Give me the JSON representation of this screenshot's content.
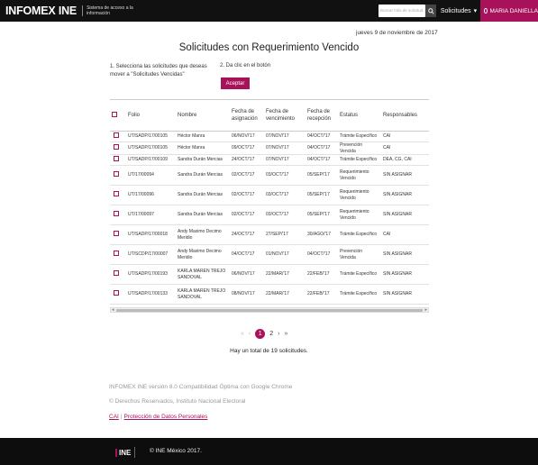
{
  "header": {
    "brand": "INFOMEX INE",
    "brand_sub": "Sistema de acceso a la información",
    "search_placeholder": "Buscar folio de solicitud",
    "solicitudes_label": "Solicitudes",
    "user_name": "MARIA DANIELLA",
    "accent": "#a8125b"
  },
  "main": {
    "date": "jueves 9 de noviembre de 2017",
    "title": "Solicitudes con Requerimiento Vencido",
    "step1": "1. Selecciona las solicitudes que deseas mover a \"Solicitudes Vencidas\"",
    "step2": "2. Da clic en el botón",
    "accept_label": "Aceptar"
  },
  "table": {
    "headers": [
      "Folio",
      "Nombre",
      "Fecha de asignación",
      "Fecha de vencimiento",
      "Fecha de recepción",
      "Estatus",
      "Responsables"
    ],
    "rows": [
      [
        "UT/SADP/17/00105",
        "Héctor Manra",
        "06/NOV/'17",
        "07/NOV/'17",
        "04/OCT/'17",
        "Trámite Específico",
        "CAI"
      ],
      [
        "UT/SADP/17/00105",
        "Héctor Manra",
        "09/OCT/'17",
        "07/NOV/'17",
        "04/OCT/'17",
        "Prevención Vencida",
        "CAI"
      ],
      [
        "UT/SADP/17/00109",
        "Sandra Durán Mercias",
        "24/OCT/'17",
        "07/NOV/'17",
        "04/OCT/'17",
        "Trámite Específico",
        "DEA, CG, CAI"
      ],
      [
        "UT/17/00094",
        "Sandra Durán Mercias",
        "02/OCT/'17",
        "03/OCT/'17",
        "05/SEP/'17",
        "Requerimiento Vencido",
        "SIN ASIGNAR"
      ],
      [
        "UT/17/00096",
        "Sandra Durán Mercias",
        "02/OCT/'17",
        "03/OCT/'17",
        "05/SEP/'17",
        "Requerimiento Vencido",
        "SIN ASIGNAR"
      ],
      [
        "UT/17/00097",
        "Sandra Durán Mercias",
        "02/OCT/'17",
        "03/OCT/'17",
        "05/SEP/'17",
        "Requerimiento Vencido",
        "SIN ASIGNAR"
      ],
      [
        "UT/SADP/17/00018",
        "Andy Maximo Decimo Meridio",
        "24/OCT/'17",
        "27/SEP/'17",
        "30/AGO/'17",
        "Trámite Específico",
        "CAI"
      ],
      [
        "UT/SCDP/17/00007",
        "Andy Maximo Decimo Meridio",
        "04/OCT/'17",
        "01/NOV/'17",
        "04/OCT/'17",
        "Prevención Vencida",
        "SIN ASIGNAR"
      ],
      [
        "UT/SADP/17/00193",
        "KARLA MAREN TREJO SANDOVAL",
        "06/NOV/'17",
        "22/MAR/'17",
        "22/FEB/'17",
        "Trámite Específico",
        "SIN ASIGNAR"
      ],
      [
        "UT/SADP/17/00133",
        "KARLA MAREN TREJO SANDOVAL",
        "08/NOV/'17",
        "22/MAR/'17",
        "22/FEB/'17",
        "Trámite Específico",
        "SIN ASIGNAR"
      ]
    ]
  },
  "pagination": {
    "first": "«",
    "prev": "‹",
    "current": "1",
    "page2": "2",
    "next": "›",
    "last": "»"
  },
  "total_text": "Hay un total de 19 solicitudes.",
  "footer": {
    "version": "INFOMEX INE versión 8.0 Compatibilidad Óptima con Google Chrome",
    "rights": "© Derechos Reservados, Instituto Nacional Electoral",
    "link_cai": "CAI",
    "link_privacy": "Protección de Datos Personales",
    "logo_text": "INE",
    "copyright": "© INE México 2017."
  }
}
